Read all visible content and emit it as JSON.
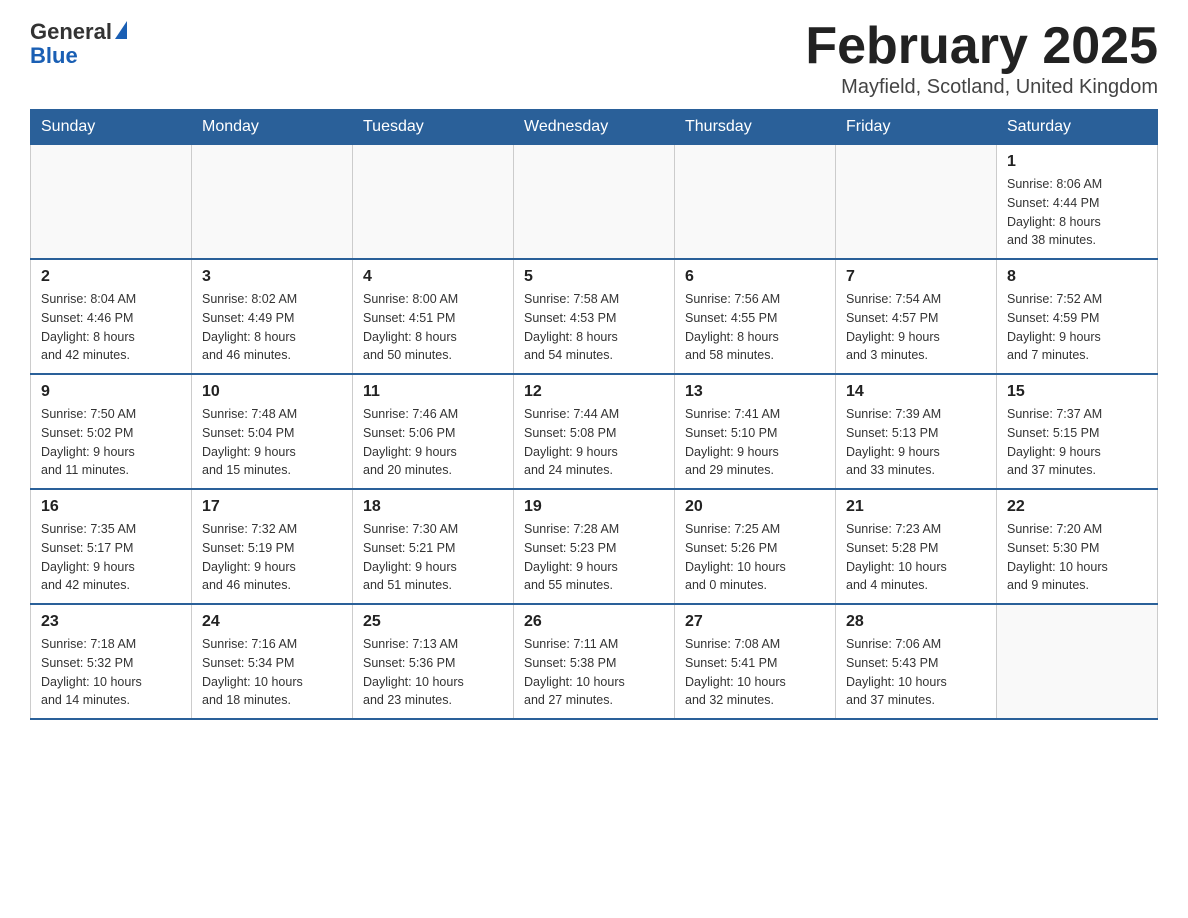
{
  "logo": {
    "general": "General",
    "blue": "Blue"
  },
  "title": "February 2025",
  "location": "Mayfield, Scotland, United Kingdom",
  "weekdays": [
    "Sunday",
    "Monday",
    "Tuesday",
    "Wednesday",
    "Thursday",
    "Friday",
    "Saturday"
  ],
  "weeks": [
    [
      {
        "num": "",
        "info": ""
      },
      {
        "num": "",
        "info": ""
      },
      {
        "num": "",
        "info": ""
      },
      {
        "num": "",
        "info": ""
      },
      {
        "num": "",
        "info": ""
      },
      {
        "num": "",
        "info": ""
      },
      {
        "num": "1",
        "info": "Sunrise: 8:06 AM\nSunset: 4:44 PM\nDaylight: 8 hours\nand 38 minutes."
      }
    ],
    [
      {
        "num": "2",
        "info": "Sunrise: 8:04 AM\nSunset: 4:46 PM\nDaylight: 8 hours\nand 42 minutes."
      },
      {
        "num": "3",
        "info": "Sunrise: 8:02 AM\nSunset: 4:49 PM\nDaylight: 8 hours\nand 46 minutes."
      },
      {
        "num": "4",
        "info": "Sunrise: 8:00 AM\nSunset: 4:51 PM\nDaylight: 8 hours\nand 50 minutes."
      },
      {
        "num": "5",
        "info": "Sunrise: 7:58 AM\nSunset: 4:53 PM\nDaylight: 8 hours\nand 54 minutes."
      },
      {
        "num": "6",
        "info": "Sunrise: 7:56 AM\nSunset: 4:55 PM\nDaylight: 8 hours\nand 58 minutes."
      },
      {
        "num": "7",
        "info": "Sunrise: 7:54 AM\nSunset: 4:57 PM\nDaylight: 9 hours\nand 3 minutes."
      },
      {
        "num": "8",
        "info": "Sunrise: 7:52 AM\nSunset: 4:59 PM\nDaylight: 9 hours\nand 7 minutes."
      }
    ],
    [
      {
        "num": "9",
        "info": "Sunrise: 7:50 AM\nSunset: 5:02 PM\nDaylight: 9 hours\nand 11 minutes."
      },
      {
        "num": "10",
        "info": "Sunrise: 7:48 AM\nSunset: 5:04 PM\nDaylight: 9 hours\nand 15 minutes."
      },
      {
        "num": "11",
        "info": "Sunrise: 7:46 AM\nSunset: 5:06 PM\nDaylight: 9 hours\nand 20 minutes."
      },
      {
        "num": "12",
        "info": "Sunrise: 7:44 AM\nSunset: 5:08 PM\nDaylight: 9 hours\nand 24 minutes."
      },
      {
        "num": "13",
        "info": "Sunrise: 7:41 AM\nSunset: 5:10 PM\nDaylight: 9 hours\nand 29 minutes."
      },
      {
        "num": "14",
        "info": "Sunrise: 7:39 AM\nSunset: 5:13 PM\nDaylight: 9 hours\nand 33 minutes."
      },
      {
        "num": "15",
        "info": "Sunrise: 7:37 AM\nSunset: 5:15 PM\nDaylight: 9 hours\nand 37 minutes."
      }
    ],
    [
      {
        "num": "16",
        "info": "Sunrise: 7:35 AM\nSunset: 5:17 PM\nDaylight: 9 hours\nand 42 minutes."
      },
      {
        "num": "17",
        "info": "Sunrise: 7:32 AM\nSunset: 5:19 PM\nDaylight: 9 hours\nand 46 minutes."
      },
      {
        "num": "18",
        "info": "Sunrise: 7:30 AM\nSunset: 5:21 PM\nDaylight: 9 hours\nand 51 minutes."
      },
      {
        "num": "19",
        "info": "Sunrise: 7:28 AM\nSunset: 5:23 PM\nDaylight: 9 hours\nand 55 minutes."
      },
      {
        "num": "20",
        "info": "Sunrise: 7:25 AM\nSunset: 5:26 PM\nDaylight: 10 hours\nand 0 minutes."
      },
      {
        "num": "21",
        "info": "Sunrise: 7:23 AM\nSunset: 5:28 PM\nDaylight: 10 hours\nand 4 minutes."
      },
      {
        "num": "22",
        "info": "Sunrise: 7:20 AM\nSunset: 5:30 PM\nDaylight: 10 hours\nand 9 minutes."
      }
    ],
    [
      {
        "num": "23",
        "info": "Sunrise: 7:18 AM\nSunset: 5:32 PM\nDaylight: 10 hours\nand 14 minutes."
      },
      {
        "num": "24",
        "info": "Sunrise: 7:16 AM\nSunset: 5:34 PM\nDaylight: 10 hours\nand 18 minutes."
      },
      {
        "num": "25",
        "info": "Sunrise: 7:13 AM\nSunset: 5:36 PM\nDaylight: 10 hours\nand 23 minutes."
      },
      {
        "num": "26",
        "info": "Sunrise: 7:11 AM\nSunset: 5:38 PM\nDaylight: 10 hours\nand 27 minutes."
      },
      {
        "num": "27",
        "info": "Sunrise: 7:08 AM\nSunset: 5:41 PM\nDaylight: 10 hours\nand 32 minutes."
      },
      {
        "num": "28",
        "info": "Sunrise: 7:06 AM\nSunset: 5:43 PM\nDaylight: 10 hours\nand 37 minutes."
      },
      {
        "num": "",
        "info": ""
      }
    ]
  ]
}
